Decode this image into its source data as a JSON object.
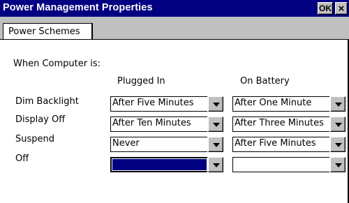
{
  "titlebar": {
    "title": "Power Management Properties",
    "ok_label": "OK",
    "close_label": "×"
  },
  "tabs": [
    {
      "label": "Power Schemes"
    }
  ],
  "panel": {
    "section_label": "When Computer is:",
    "col_plugged": "Plugged In",
    "col_battery": "On Battery",
    "rows": [
      {
        "label": "Dim Backlight",
        "plugged": "After Five Minutes",
        "battery": "After One Minute"
      },
      {
        "label": "Display Off",
        "plugged": "After Ten Minutes",
        "battery": "After Three Minutes"
      },
      {
        "label": "Suspend",
        "plugged": "Never",
        "battery": "After Five Minutes"
      },
      {
        "label": "Off",
        "plugged": "",
        "battery": ""
      }
    ]
  },
  "colors": {
    "titlebar": "#000080",
    "selection": "#000080",
    "face": "#c0c0c0"
  }
}
